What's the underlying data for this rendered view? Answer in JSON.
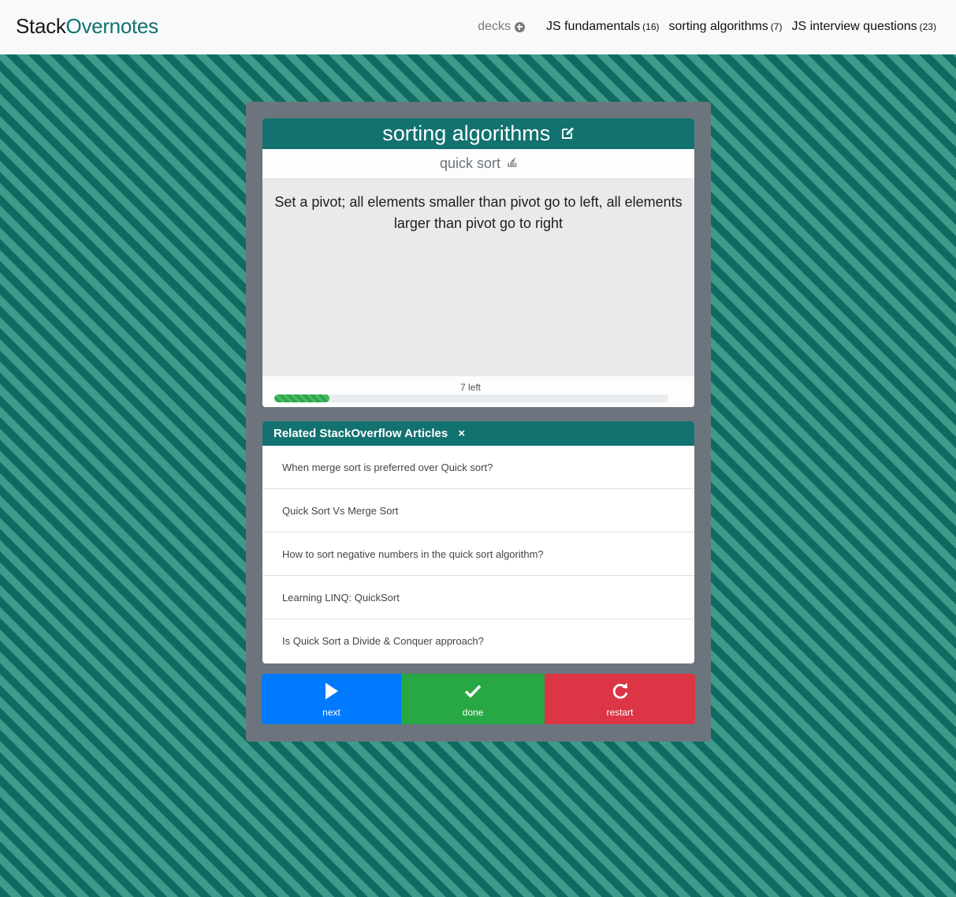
{
  "navbar": {
    "brand_part1": "Stack",
    "brand_part2": "Overnotes",
    "decks_label": "decks",
    "decks": [
      {
        "label": "JS fundamentals",
        "count": "(16)"
      },
      {
        "label": "sorting algorithms",
        "count": "(7)"
      },
      {
        "label": "JS interview questions",
        "count": "(23)"
      }
    ]
  },
  "card": {
    "deck_title": "sorting algorithms",
    "card_title": "quick sort",
    "answer": "Set a pivot; all elements smaller than pivot go to left, all elements larger than pivot go to right",
    "left_text": "7 left",
    "progress_percent": 14
  },
  "related": {
    "title": "Related StackOverflow Articles",
    "close_symbol": "×",
    "articles": [
      "When merge sort is preferred over Quick sort?",
      "Quick Sort Vs Merge Sort",
      "How to sort negative numbers in the quick sort algorithm?",
      "Learning LINQ: QuickSort",
      "Is Quick Sort a Divide & Conquer approach?"
    ]
  },
  "buttons": {
    "next_label": "next",
    "done_label": "done",
    "restart_label": "restart"
  },
  "colors": {
    "accent": "#127270",
    "next": "#007bff",
    "done": "#28a745",
    "restart": "#dc3545",
    "panel": "#6c757d"
  },
  "icons": {
    "decks": "plus-circle-icon",
    "deck_title": "edit-icon",
    "card_title": "stackoverflow-icon",
    "next": "play-icon",
    "done": "check-icon",
    "restart": "redo-icon"
  }
}
